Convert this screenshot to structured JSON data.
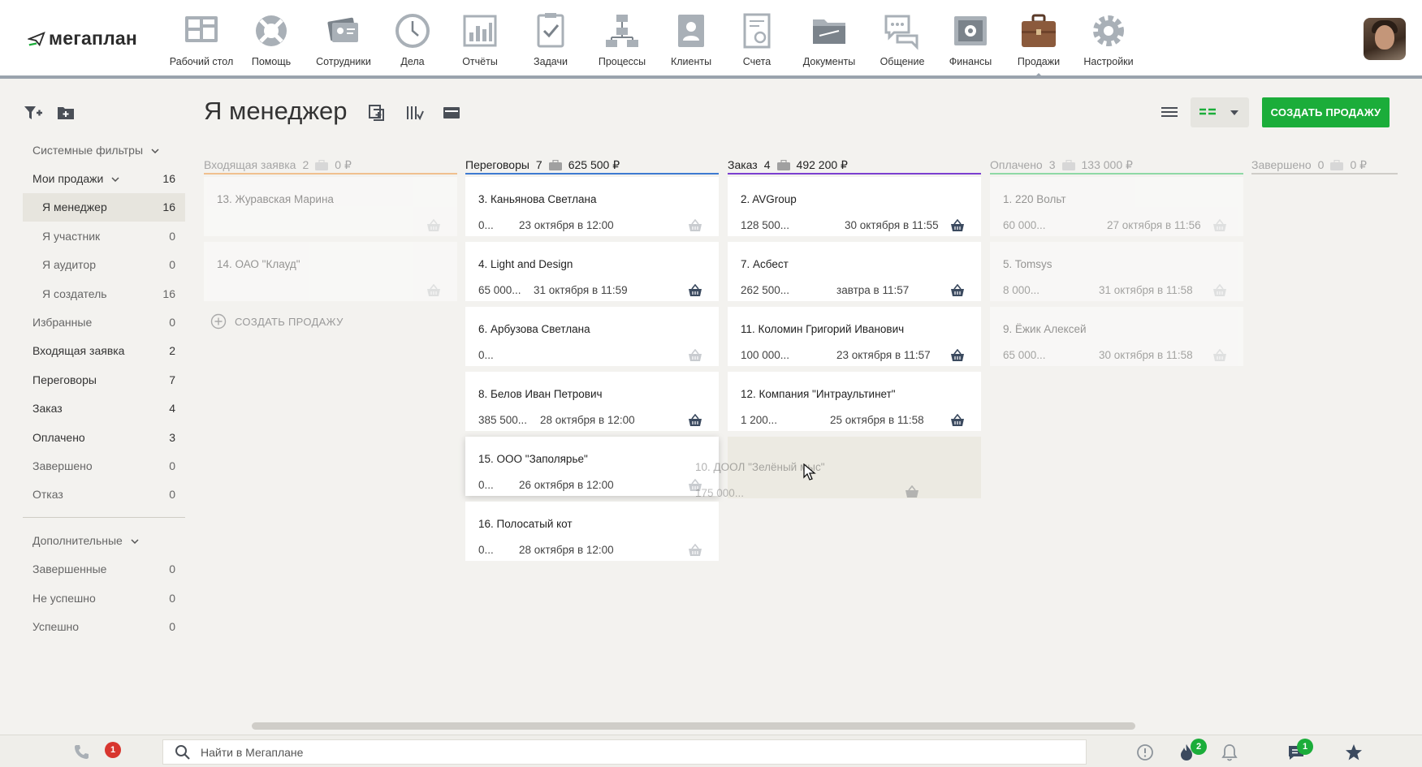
{
  "app": {
    "logo_text": "мегаплан",
    "brand_color": "#1bad3a"
  },
  "nav": [
    {
      "label": "Рабочий стол",
      "icon": "desktop-icon"
    },
    {
      "label": "Помощь",
      "icon": "lifebuoy-icon"
    },
    {
      "label": "Сотрудники",
      "icon": "employees-icon"
    },
    {
      "label": "Дела",
      "icon": "clock-icon"
    },
    {
      "label": "Отчёты",
      "icon": "reports-icon"
    },
    {
      "label": "Задачи",
      "icon": "tasks-icon"
    },
    {
      "label": "Процессы",
      "icon": "processes-icon"
    },
    {
      "label": "Клиенты",
      "icon": "clients-icon"
    },
    {
      "label": "Счета",
      "icon": "invoices-icon"
    },
    {
      "label": "Документы",
      "icon": "documents-icon"
    },
    {
      "label": "Общение",
      "icon": "chat-icon"
    },
    {
      "label": "Финансы",
      "icon": "safe-icon"
    },
    {
      "label": "Продажи",
      "icon": "briefcase-icon",
      "active": true
    },
    {
      "label": "Настройки",
      "icon": "gear-icon"
    }
  ],
  "page": {
    "title": "Я менеджер",
    "create_button": "СОЗДАТЬ ПРОДАЖУ"
  },
  "sidebar": {
    "items": [
      {
        "label": "Системные фильтры",
        "count": "",
        "caret": true
      },
      {
        "label": "Мои продажи",
        "count": "16",
        "caret": true
      },
      {
        "label": "Я менеджер",
        "count": "16",
        "sub": true,
        "selected": true
      },
      {
        "label": "Я участник",
        "count": "0",
        "sub": true
      },
      {
        "label": "Я аудитор",
        "count": "0",
        "sub": true
      },
      {
        "label": "Я создатель",
        "count": "16",
        "sub": true
      },
      {
        "label": "Избранные",
        "count": "0"
      },
      {
        "label": "Входящая заявка",
        "count": "2"
      },
      {
        "label": "Переговоры",
        "count": "7"
      },
      {
        "label": "Заказ",
        "count": "4"
      },
      {
        "label": "Оплачено",
        "count": "3"
      },
      {
        "label": "Завершено",
        "count": "0"
      },
      {
        "label": "Отказ",
        "count": "0"
      }
    ],
    "extra": [
      {
        "label": "Дополнительные",
        "count": "",
        "caret": true
      },
      {
        "label": "Завершенные",
        "count": "0"
      },
      {
        "label": "Не успешно",
        "count": "0"
      },
      {
        "label": "Успешно",
        "count": "0"
      }
    ]
  },
  "board": {
    "columns": [
      {
        "name": "Входящая заявка",
        "count": "2",
        "sum": "0 ₽",
        "color": "#f0c08e",
        "faded": true,
        "cards": [
          {
            "title": "13. Журавская Марина",
            "sum": "",
            "date": "",
            "faded": true
          },
          {
            "title": "14. ОАО \"Клауд\"",
            "sum": "",
            "date": "",
            "faded": true
          }
        ]
      },
      {
        "name": "Переговоры",
        "count": "7",
        "sum": "625 500 ₽",
        "color": "#3e7ad1",
        "faded": false,
        "cards": [
          {
            "title": "3. Каньянова Светлана",
            "sum": "0...",
            "date": "23 октября в 12:00"
          },
          {
            "title": "4. Light and Design",
            "sum": "65 000...",
            "date": "31 октября в 11:59",
            "dark": true
          },
          {
            "title": "6. Арбузова Светлана",
            "sum": "0...",
            "date": ""
          },
          {
            "title": "8. Белов Иван Петрович",
            "sum": "385 500...",
            "date": "28 октября в 12:00",
            "dark": true
          },
          {
            "title": "15. ООО \"Заполярье\"",
            "sum": "0...",
            "date": "26 октября в 12:00",
            "shadow": true
          },
          {
            "title": "16. Полосатый кот",
            "sum": "0...",
            "date": "28 октября в 12:00"
          }
        ]
      },
      {
        "name": "Заказ",
        "count": "4",
        "sum": "492 200 ₽",
        "color": "#7b3fd0",
        "faded": false,
        "cards": [
          {
            "title": "2. AVGroup",
            "sum": "128 500...",
            "date": "30 октября в 11:55",
            "dark": true
          },
          {
            "title": "7. Асбест",
            "sum": "262 500...",
            "date": "завтра в 11:57",
            "dark": true
          },
          {
            "title": "11. Коломин Григорий Иванович",
            "sum": "100 000...",
            "date": "23 октября в 11:57",
            "dark": true
          },
          {
            "title": "12. Компания \"Интраультинет\"",
            "sum": "1 200...",
            "date": "25 октября в 11:58",
            "dark": true
          }
        ]
      },
      {
        "name": "Оплачено",
        "count": "3",
        "sum": "133 000 ₽",
        "color": "#8fd9a6",
        "faded": true,
        "cards": [
          {
            "title": "1. 220 Вольт",
            "sum": "60 000...",
            "date": "27 октября в 11:56",
            "faded": true
          },
          {
            "title": "5. Tomsys",
            "sum": "8 000...",
            "date": "31 октября в 11:58",
            "faded": true
          },
          {
            "title": "9. Ёжик Алексей",
            "sum": "65 000...",
            "date": "30 октября в 11:58",
            "faded": true
          }
        ]
      },
      {
        "name": "Завершено",
        "count": "0",
        "sum": "0 ₽",
        "color": "#cfcdc8",
        "faded": true,
        "cards": []
      }
    ],
    "add_sale_label": "СОЗДАТЬ ПРОДАЖУ",
    "dragging": {
      "title": "10. ДООЛ \"Зелёный мыс\"",
      "sum": "175 000..."
    }
  },
  "bottom": {
    "phone_badge": "1",
    "search_placeholder": "Найти в Мегаплане",
    "fire_badge": "2",
    "chat_badge": "1"
  }
}
